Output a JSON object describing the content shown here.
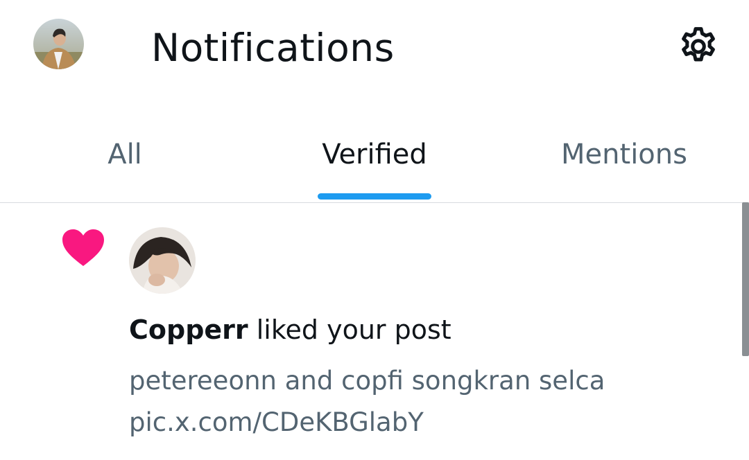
{
  "header": {
    "title": "Notifications",
    "avatar_icon": "profile-avatar",
    "settings_icon": "gear-icon"
  },
  "tabs": [
    {
      "label": "All",
      "active": false
    },
    {
      "label": "Verified",
      "active": true
    },
    {
      "label": "Mentions",
      "active": false
    }
  ],
  "notification": {
    "type_icon": "heart-icon",
    "user": "Copperr",
    "action": "liked your post",
    "post_text": "petereeonn and copfi songkran selca",
    "post_link": "pic.x.com/CDeKBGlabY"
  },
  "colors": {
    "accent": "#1d9bf0",
    "heart": "#f91880",
    "text_primary": "#0f1419",
    "text_secondary": "#536471"
  }
}
